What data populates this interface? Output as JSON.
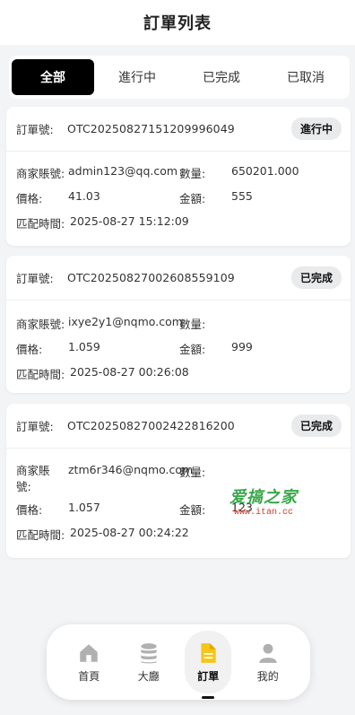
{
  "header": {
    "title": "訂單列表"
  },
  "tabs": [
    {
      "label": "全部"
    },
    {
      "label": "進行中"
    },
    {
      "label": "已完成"
    },
    {
      "label": "已取消"
    }
  ],
  "orders": [
    {
      "order_label": "訂單號:",
      "order_id": "OTC20250827151209996049",
      "status": "進行中",
      "merchant_label": "商家賬號:",
      "merchant": "admin123@qq.com",
      "qty_label": "數量:",
      "qty": "650201.000",
      "price_label": "價格:",
      "price": "41.03",
      "amount_label": "金額:",
      "amount": "555",
      "time_label": "匹配時間:",
      "time": "2025-08-27 15:12:09"
    },
    {
      "order_label": "訂單號:",
      "order_id": "OTC20250827002608559109",
      "status": "已完成",
      "merchant_label": "商家賬號:",
      "merchant": "ixye2y1@nqmo.com",
      "qty_label": "數量:",
      "qty": "",
      "price_label": "價格:",
      "price": "1.059",
      "amount_label": "金額:",
      "amount": "999",
      "time_label": "匹配時間:",
      "time": "2025-08-27 00:26:08"
    },
    {
      "order_label": "訂單號:",
      "order_id": "OTC20250827002422816200",
      "status": "已完成",
      "merchant_label": "商家賬號:",
      "merchant": "ztm6r346@nqmo.com",
      "qty_label": "數量:",
      "qty": "",
      "price_label": "價格:",
      "price": "1.057",
      "amount_label": "金額:",
      "amount": "123",
      "time_label": "匹配時間:",
      "time": "2025-08-27 00:24:22"
    }
  ],
  "watermark": {
    "title": "爱搞之家",
    "url": "www.itan.cc"
  },
  "nav": [
    {
      "label": "首頁",
      "icon": "home-icon"
    },
    {
      "label": "大廳",
      "icon": "database-icon"
    },
    {
      "label": "訂單",
      "icon": "document-icon"
    },
    {
      "label": "我的",
      "icon": "user-icon"
    }
  ],
  "colors": {
    "active_tab": "#000000",
    "active_nav_icon": "#f5c518",
    "inactive_icon": "#a9a9a9"
  }
}
